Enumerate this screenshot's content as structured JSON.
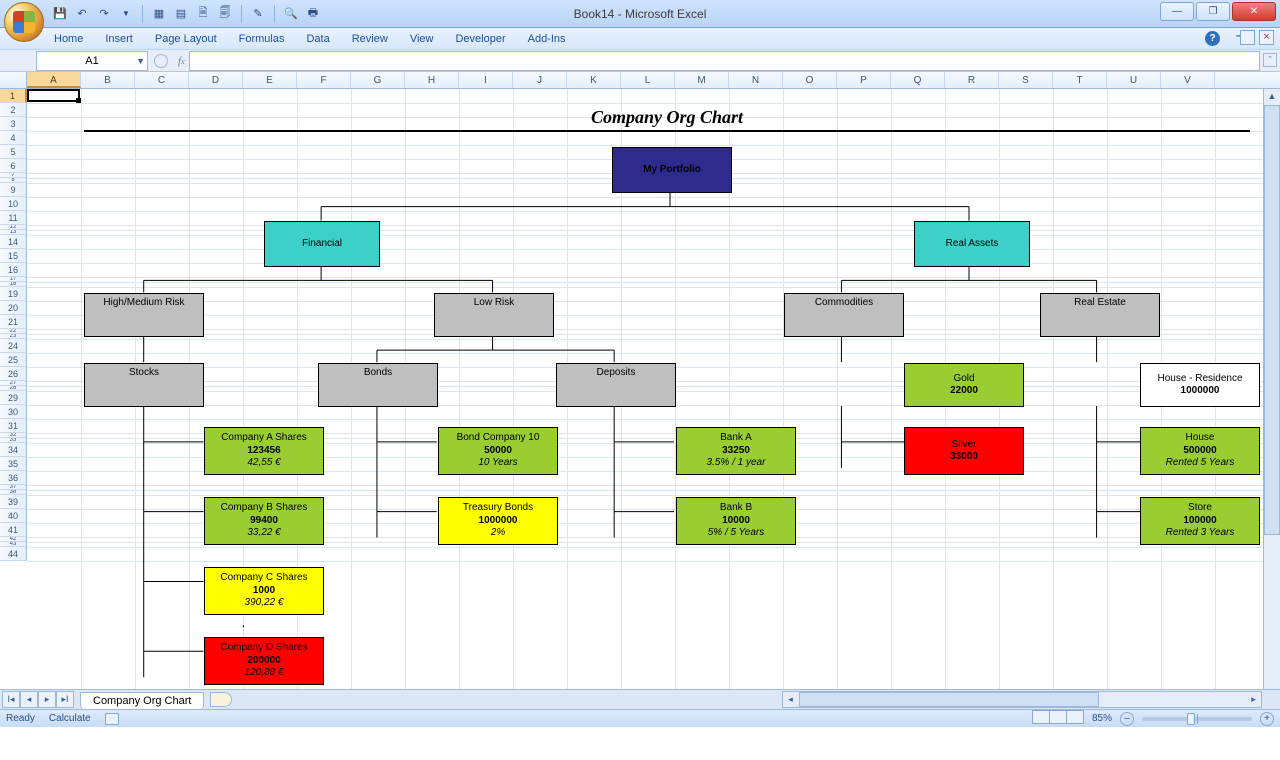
{
  "window": {
    "title": "Book14 - Microsoft Excel"
  },
  "ribbon_tabs": [
    "Home",
    "Insert",
    "Page Layout",
    "Formulas",
    "Data",
    "Review",
    "View",
    "Developer",
    "Add-Ins"
  ],
  "namebox": "A1",
  "columns": [
    "A",
    "B",
    "C",
    "D",
    "E",
    "F",
    "G",
    "H",
    "I",
    "J",
    "K",
    "L",
    "M",
    "N",
    "O",
    "P",
    "Q",
    "R",
    "S",
    "T",
    "U",
    "V"
  ],
  "sheet_tab": "Company Org Chart",
  "status": {
    "left1": "Ready",
    "left2": "Calculate",
    "zoom": "85%"
  },
  "chart": {
    "title": "Company Org Chart",
    "root": {
      "label": "My Portfolio"
    },
    "l2": {
      "a": "Financial",
      "b": "Real Assets"
    },
    "l3": {
      "a": "High/Medium Risk",
      "b": "Low Risk",
      "c": "Commodities",
      "d": "Real Estate"
    },
    "l4": {
      "a": "Stocks",
      "b": "Bonds",
      "c": "Deposits",
      "gold": {
        "t": "Gold",
        "v": "22000"
      },
      "houseR": {
        "t": "House - Residence",
        "v": "1000000"
      }
    },
    "leaves": {
      "s0": {
        "t": "Company A Shares",
        "v": "123456",
        "d": "42,55 €"
      },
      "s1": {
        "t": "Company B Shares",
        "v": "99400",
        "d": "33,22 €"
      },
      "s2": {
        "t": "Company C Shares",
        "v": "1000",
        "d": "390,22 €"
      },
      "s3": {
        "t": "Company D Shares",
        "v": "200000",
        "d": "120,88 €"
      },
      "b0": {
        "t": "Bond Company 10",
        "v": "50000",
        "d": "10 Years"
      },
      "b1": {
        "t": "Treasury Bonds",
        "v": "1000000",
        "d": "2%"
      },
      "d0": {
        "t": "Bank A",
        "v": "33250",
        "d": "3.5% / 1 year"
      },
      "d1": {
        "t": "Bank B",
        "v": "10000",
        "d": "5% / 5 Years"
      },
      "silver": {
        "t": "Silver",
        "v": "33000"
      },
      "house": {
        "t": "House",
        "v": "500000",
        "d": "Rented 5 Years"
      },
      "store": {
        "t": "Store",
        "v": "100000",
        "d": "Rented 3 Years"
      }
    }
  },
  "chart_data": {
    "type": "tree",
    "title": "Company Org Chart",
    "root": {
      "name": "My Portfolio",
      "children": [
        {
          "name": "Financial",
          "children": [
            {
              "name": "High/Medium Risk",
              "children": [
                {
                  "name": "Stocks",
                  "children": [
                    {
                      "name": "Company A Shares",
                      "value": 123456,
                      "detail": "42,55 €"
                    },
                    {
                      "name": "Company B Shares",
                      "value": 99400,
                      "detail": "33,22 €"
                    },
                    {
                      "name": "Company C Shares",
                      "value": 1000,
                      "detail": "390,22 €"
                    },
                    {
                      "name": "Company D Shares",
                      "value": 200000,
                      "detail": "120,88 €"
                    }
                  ]
                }
              ]
            },
            {
              "name": "Low Risk",
              "children": [
                {
                  "name": "Bonds",
                  "children": [
                    {
                      "name": "Bond Company 10",
                      "value": 50000,
                      "detail": "10 Years"
                    },
                    {
                      "name": "Treasury Bonds",
                      "value": 1000000,
                      "detail": "2%"
                    }
                  ]
                },
                {
                  "name": "Deposits",
                  "children": [
                    {
                      "name": "Bank A",
                      "value": 33250,
                      "detail": "3.5% / 1 year"
                    },
                    {
                      "name": "Bank B",
                      "value": 10000,
                      "detail": "5% / 5 Years"
                    }
                  ]
                }
              ]
            }
          ]
        },
        {
          "name": "Real Assets",
          "children": [
            {
              "name": "Commodities",
              "children": [
                {
                  "name": "Gold",
                  "value": 22000
                },
                {
                  "name": "Silver",
                  "value": 33000
                }
              ]
            },
            {
              "name": "Real Estate",
              "children": [
                {
                  "name": "House - Residence",
                  "value": 1000000
                },
                {
                  "name": "House",
                  "value": 500000,
                  "detail": "Rented 5 Years"
                },
                {
                  "name": "Store",
                  "value": 100000,
                  "detail": "Rented 3 Years"
                }
              ]
            }
          ]
        }
      ]
    }
  }
}
